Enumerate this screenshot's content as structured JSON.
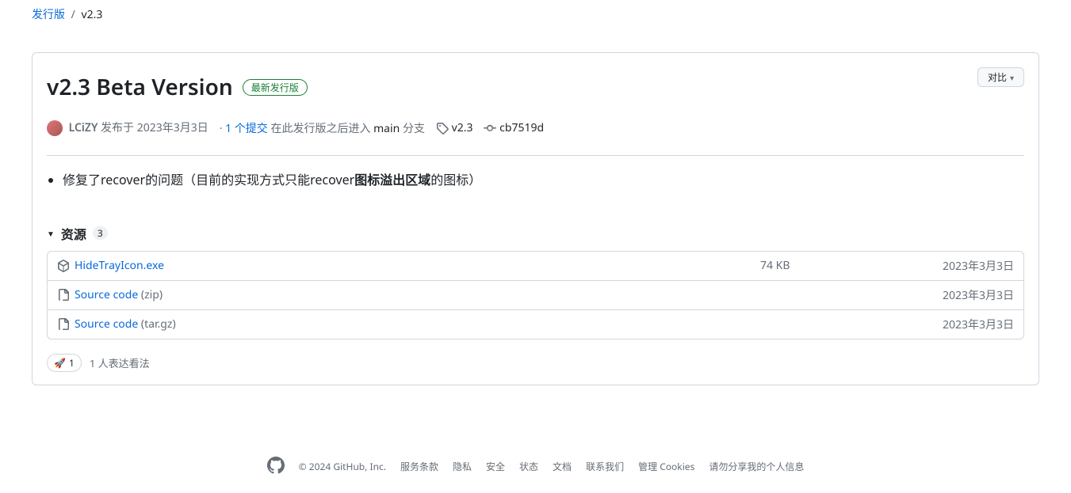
{
  "breadcrumb": {
    "root": "发行版",
    "sep": "/",
    "current": "v2.3"
  },
  "compare_label": "对比",
  "release": {
    "title": "v2.3 Beta Version",
    "latest_badge": "最新发行版",
    "author": "LCiZY",
    "published_prefix": "发布于",
    "published_date": "2023年3月3日",
    "commits_link": "1 个提交",
    "commits_suffix_1": "在此发行版之后进入",
    "branch": "main",
    "commits_suffix_2": "分支",
    "tag": "v2.3",
    "commit_sha": "cb7519d",
    "body_items": [
      {
        "pre": "修复了recover的问题（目前的实现方式只能recover",
        "bold": "图标溢出区域",
        "post": "的图标）"
      }
    ]
  },
  "assets": {
    "header": "资源",
    "count": "3",
    "rows": [
      {
        "name": "HideTrayIcon.exe",
        "secondary": "",
        "size": "74 KB",
        "date": "2023年3月3日",
        "icon": "package"
      },
      {
        "name": "Source code",
        "secondary": "(zip)",
        "size": "",
        "date": "2023年3月3日",
        "icon": "zip"
      },
      {
        "name": "Source code",
        "secondary": "(tar.gz)",
        "size": "",
        "date": "2023年3月3日",
        "icon": "zip"
      }
    ]
  },
  "reactions": {
    "emoji": "🚀",
    "count": "1",
    "text": "1 人表达看法"
  },
  "footer": {
    "copyright": "© 2024 GitHub, Inc.",
    "links": [
      "服务条款",
      "隐私",
      "安全",
      "状态",
      "文档",
      "联系我们",
      "管理 Cookies",
      "请勿分享我的个人信息"
    ]
  }
}
